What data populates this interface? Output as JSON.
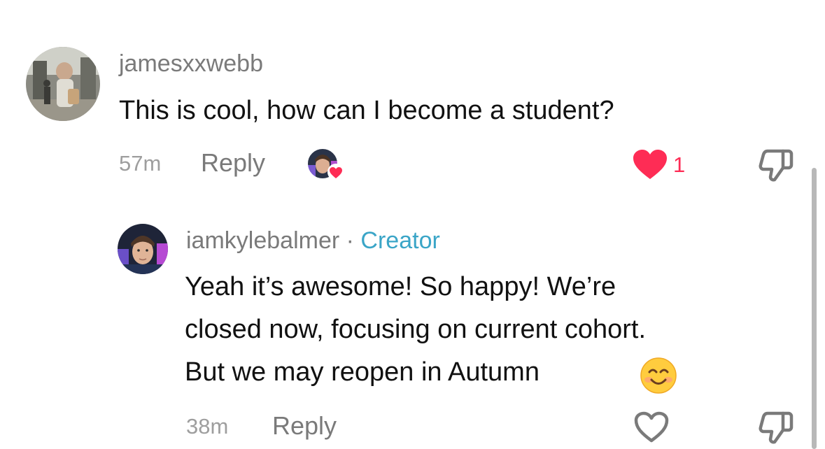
{
  "comments": [
    {
      "username": "jamesxxwebb",
      "text": "This is cool, how can I become a student?",
      "time": "57m",
      "reply_label": "Reply",
      "likes": "1",
      "liked": true,
      "avatar_icon": "user-photo-avatar"
    }
  ],
  "replies": [
    {
      "username": "iamkylebalmer",
      "separator": "·",
      "badge": "Creator",
      "text_lines": [
        "Yeah it’s awesome! So happy! We’re",
        "closed now, focusing on current cohort.",
        "But we may reopen in Autumn"
      ],
      "emoji": "😊",
      "time": "38m",
      "reply_label": "Reply",
      "liked": false
    }
  ],
  "colors": {
    "like_red": "#fe2c55",
    "creator_blue": "#3aa5c7",
    "muted_text": "#7a7a7a",
    "body_text": "#111111"
  },
  "icons": {
    "like_filled": "heart-filled-icon",
    "like_outline": "heart-outline-icon",
    "dislike": "thumbs-down-icon",
    "creator_liked": "creator-liked-badge-icon"
  }
}
